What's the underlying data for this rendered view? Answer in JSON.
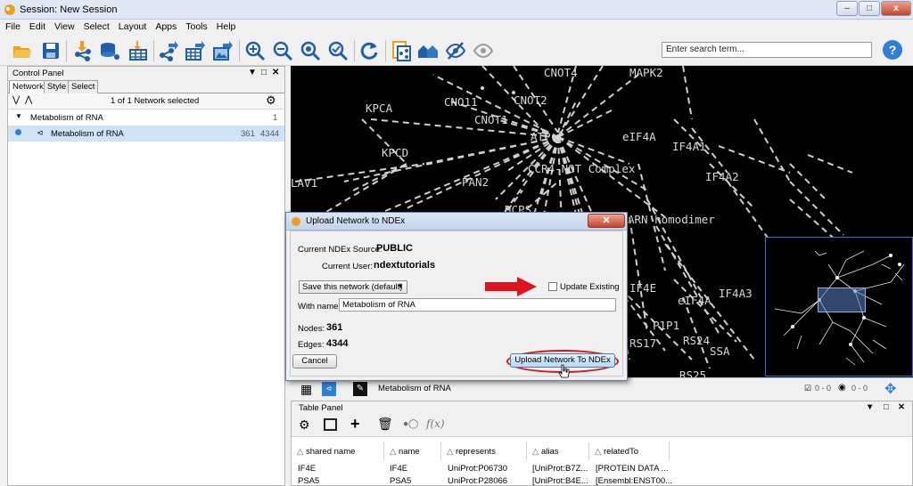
{
  "window": {
    "title": "Session: New Session",
    "minimize": "–",
    "maximize": "□",
    "close": "x"
  },
  "menu": [
    "File",
    "Edit",
    "View",
    "Select",
    "Layout",
    "Apps",
    "Tools",
    "Help"
  ],
  "search": {
    "placeholder": "Enter search term..."
  },
  "help_label": "?",
  "control_panel": {
    "title": "Control Panel",
    "tabs": [
      "Network",
      "Style",
      "Select"
    ],
    "selection_text": "1 of 1 Network selected",
    "collection": {
      "name": "Metabolism of RNA",
      "count": "1"
    },
    "network": {
      "name": "Metabolism of RNA",
      "nodes": "361",
      "edges": "4344"
    }
  },
  "network_labels": [
    "KPCA",
    "CNO11",
    "CNOT4",
    "CNOT2",
    "CNOT1",
    "ATP",
    "MAPK2",
    "KPCD",
    "eIF4A",
    "IF4A1",
    "CCR4-NOT Complex",
    "IF4A2",
    "LAV1",
    "PAN2",
    "DCPS",
    "ARN homodimer",
    "IF4E",
    "eIF4A",
    "IF4A3",
    "P1P1",
    "RS17",
    "RS24",
    "RS25",
    "SSA"
  ],
  "statusbar": {
    "network_name": "Metabolism of RNA",
    "selected_nodes": "0 - 0",
    "selected_edges": "0 - 0"
  },
  "table_panel": {
    "title": "Table Panel",
    "columns": [
      "shared name",
      "name",
      "represents",
      "alias",
      "relatedTo"
    ],
    "rows": [
      [
        "IF4E",
        "IF4E",
        "UniProt:P06730",
        "[UniProt:B7Z...",
        "[PROTEIN DATA ..."
      ],
      [
        "PSA5",
        "PSA5",
        "UniProt:P28066",
        "[UniProt:B4E...",
        "[Ensembl:ENST00..."
      ]
    ]
  },
  "dialog": {
    "title": "Upload Network to NDEx",
    "source_label": "Current NDEx Source:",
    "source_value": "PUBLIC",
    "user_label": "Current User:",
    "user_value": "ndextutorials",
    "save_option": "Save this network (default)",
    "update_existing": "Update Existing",
    "update_existing_checked": false,
    "name_label": "With name:",
    "name_value": "Metabolism of RNA",
    "nodes_label": "Nodes:",
    "nodes_value": "361",
    "edges_label": "Edges:",
    "edges_value": "4344",
    "cancel": "Cancel",
    "upload": "Upload Network To NDEx"
  },
  "colors": {
    "accent": "#2f7fd6",
    "annotation_red": "#e0141e",
    "network_bg": "#000000"
  }
}
